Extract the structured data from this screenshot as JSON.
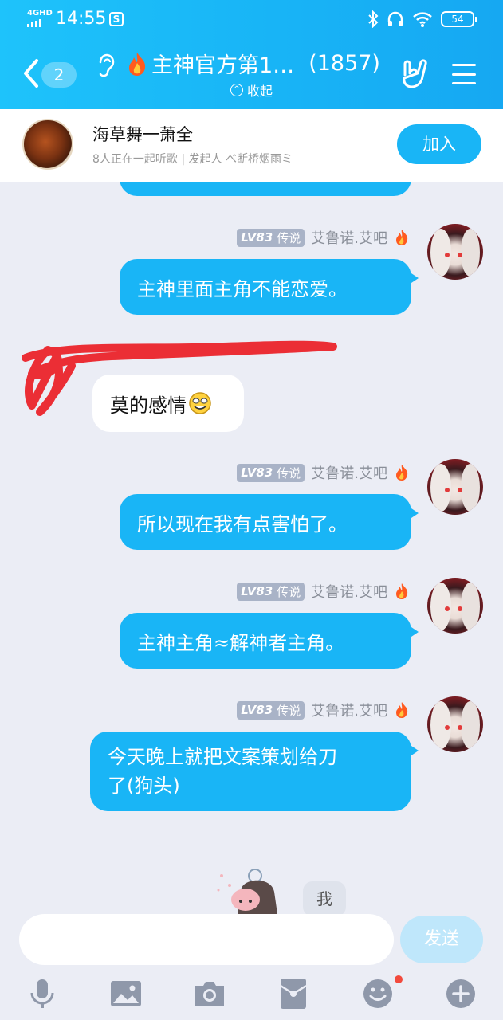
{
  "status_bar": {
    "network": "4GHD",
    "time": "14:55",
    "battery": "54"
  },
  "header": {
    "unread_count": "2",
    "title": "主神官方第1…",
    "member_count": "(1857)",
    "collapse_label": "收起"
  },
  "listen_together": {
    "song": "海草舞一萧全",
    "info": "8人正在一起听歌 | 发起人 べ断桥烟雨ミ",
    "join_label": "加入"
  },
  "messages": [
    {
      "direction": "out",
      "level": "LV83",
      "title": "传说",
      "sender": "艾鲁诺.艾吧",
      "text": "主神里面主角不能恋爱。"
    },
    {
      "direction": "in",
      "text": "莫的感情"
    },
    {
      "direction": "out",
      "level": "LV83",
      "title": "传说",
      "sender": "艾鲁诺.艾吧",
      "text": "所以现在我有点害怕了。"
    },
    {
      "direction": "out",
      "level": "LV83",
      "title": "传说",
      "sender": "艾鲁诺.艾吧",
      "text": "主神主角≈解神者主角。"
    },
    {
      "direction": "out",
      "level": "LV83",
      "title": "传说",
      "sender": "艾鲁诺.艾吧",
      "text_line1": "今天晚上就把文案策划给刀",
      "text_line2": "了(狗头)"
    }
  ],
  "me_label": "我",
  "composer": {
    "input_value": "",
    "send_label": "发送"
  },
  "toolbar_icons": [
    "microphone-icon",
    "image-icon",
    "camera-icon",
    "red-packet-icon",
    "emoji-icon",
    "plus-icon"
  ],
  "colors": {
    "accent": "#19b5f6",
    "bubble_in": "#ffffff",
    "background": "#ebedf5"
  }
}
